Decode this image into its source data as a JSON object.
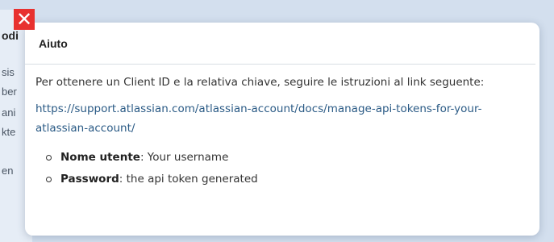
{
  "background": {
    "fragments": [
      "odi",
      "sis",
      "ber",
      "ani",
      "kte",
      "en"
    ]
  },
  "close_button": {
    "glyph": "✕"
  },
  "dialog": {
    "title": "Aiuto",
    "intro": "Per ottenere un Client ID e la relativa chiave, seguire le istruzioni al link seguente:",
    "link_text": "https://support.atlassian.com/atlassian-account/docs/manage-api-tokens-for-your-atlassian-account/",
    "credentials": [
      {
        "label": "Nome utente",
        "value": ": Your username"
      },
      {
        "label": "Password",
        "value": ": the api token generated"
      }
    ]
  }
}
